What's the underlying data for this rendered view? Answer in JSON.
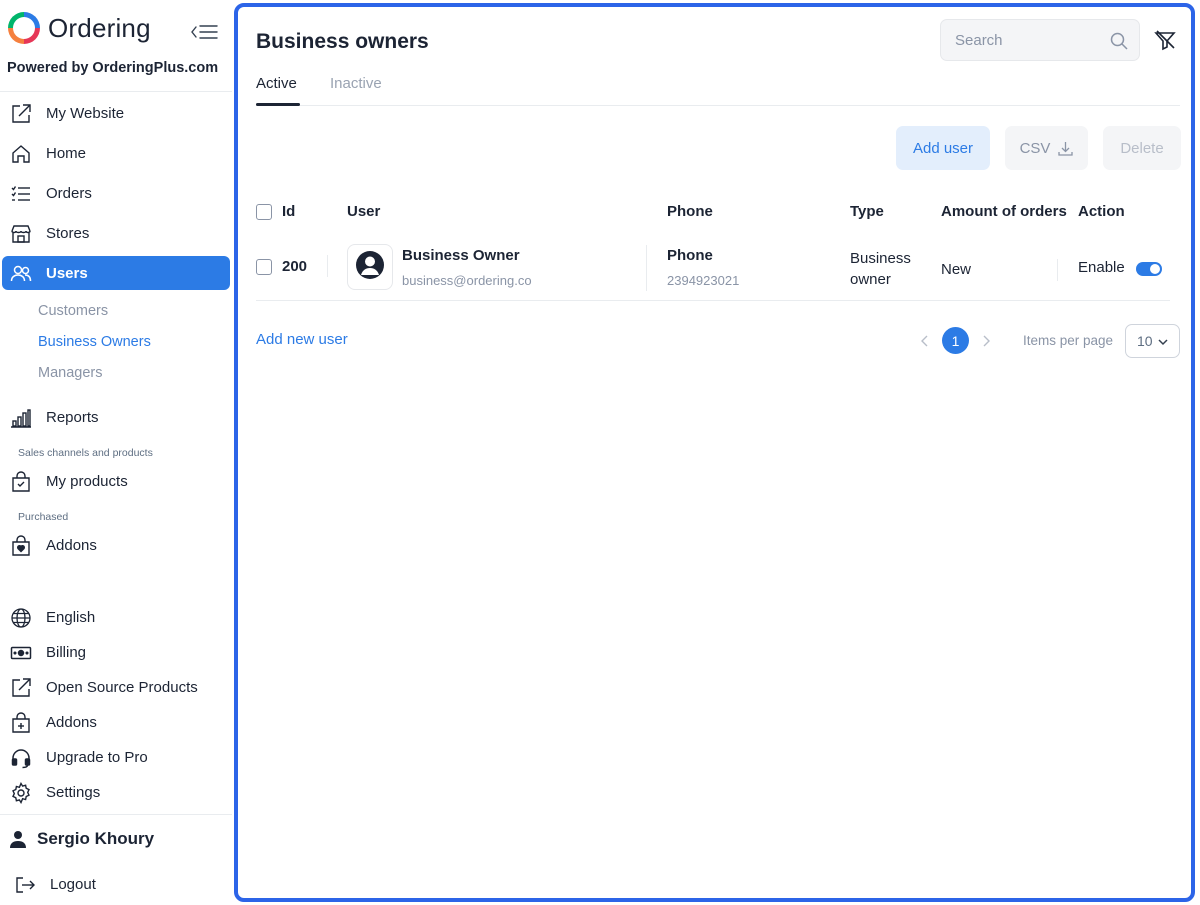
{
  "sidebar": {
    "brand_name": "Ordering",
    "powered_by": "Powered by OrderingPlus.com",
    "nav": {
      "my_website": "My Website",
      "home": "Home",
      "orders": "Orders",
      "stores": "Stores",
      "users": "Users",
      "reports": "Reports",
      "my_products": "My products",
      "addons_purchased": "Addons",
      "english": "English",
      "billing": "Billing",
      "open_source": "Open Source Products",
      "addons": "Addons",
      "upgrade": "Upgrade to Pro",
      "settings": "Settings",
      "logout": "Logout"
    },
    "users_submenu": [
      "Customers",
      "Business Owners",
      "Managers"
    ],
    "section_sales": "Sales channels and products",
    "section_purchased": "Purchased",
    "user_name": "Sergio Khoury"
  },
  "header": {
    "title": "Business owners",
    "search_placeholder": "Search"
  },
  "tabs": [
    "Active",
    "Inactive"
  ],
  "toolbar": {
    "add_user": "Add user",
    "csv": "CSV",
    "delete": "Delete"
  },
  "table": {
    "columns": {
      "id": "Id",
      "user": "User",
      "phone": "Phone",
      "type": "Type",
      "orders": "Amount of orders",
      "action": "Action"
    },
    "rows": [
      {
        "id": "200",
        "name": "Business Owner",
        "email": "business@ordering.co",
        "phone_label": "Phone",
        "phone": "2394923021",
        "type_line1": "Business",
        "type_line2": "owner",
        "orders": "New",
        "action_label": "Enable"
      }
    ]
  },
  "footer": {
    "add_new_user": "Add new user",
    "current_page": "1",
    "items_per_page_label": "Items per page",
    "items_per_page_value": "10"
  },
  "colors": {
    "accent": "#2c7be5",
    "panel_border": "#2c64e8"
  }
}
